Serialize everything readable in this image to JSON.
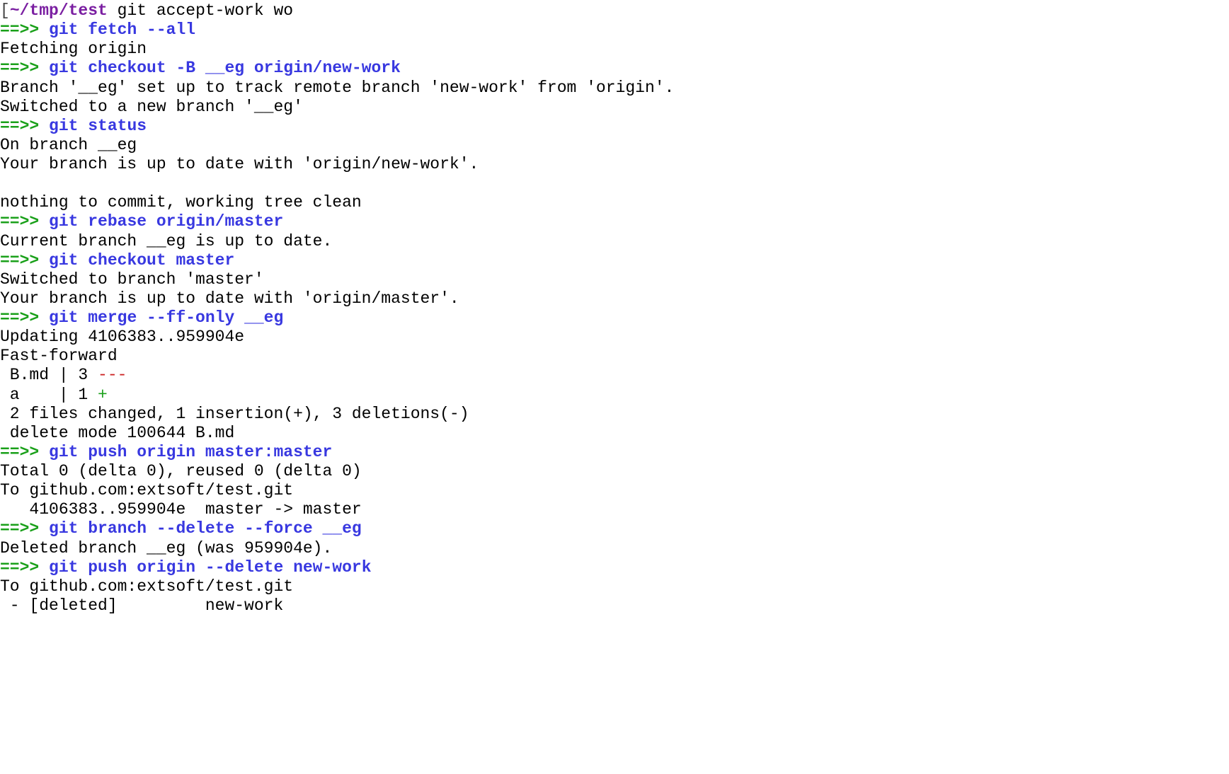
{
  "prompt": {
    "bracket": "[",
    "cwd": "~/tmp/test",
    "typed": " git accept-work wo"
  },
  "arrow": "==>>",
  "steps": [
    {
      "cmd": " git fetch --all",
      "out": [
        "Fetching origin"
      ]
    },
    {
      "cmd": " git checkout -B __eg origin/new-work",
      "out": [
        "Branch '__eg' set up to track remote branch 'new-work' from 'origin'.",
        "Switched to a new branch '__eg'"
      ]
    },
    {
      "cmd": " git status",
      "out": [
        "On branch __eg",
        "Your branch is up to date with 'origin/new-work'.",
        "",
        "nothing to commit, working tree clean"
      ]
    },
    {
      "cmd": " git rebase origin/master",
      "out": [
        "Current branch __eg is up to date."
      ]
    },
    {
      "cmd": " git checkout master",
      "out": [
        "Switched to branch 'master'",
        "Your branch is up to date with 'origin/master'."
      ]
    },
    {
      "cmd": " git merge --ff-only __eg",
      "out": [
        "Updating 4106383..959904e",
        "Fast-forward"
      ],
      "diffstat": [
        {
          "file": " B.md | 3 ",
          "marks": "---",
          "marksClass": "red"
        },
        {
          "file": " a    | 1 ",
          "marks": "+",
          "marksClass": "green"
        }
      ],
      "out2": [
        " 2 files changed, 1 insertion(+), 3 deletions(-)",
        " delete mode 100644 B.md"
      ]
    },
    {
      "cmd": " git push origin master:master",
      "out": [
        "Total 0 (delta 0), reused 0 (delta 0)",
        "To github.com:extsoft/test.git",
        "   4106383..959904e  master -> master"
      ]
    },
    {
      "cmd": " git branch --delete --force __eg",
      "out": [
        "Deleted branch __eg (was 959904e)."
      ]
    },
    {
      "cmd": " git push origin --delete new-work",
      "out": [
        "To github.com:extsoft/test.git",
        " - [deleted]         new-work"
      ]
    }
  ]
}
